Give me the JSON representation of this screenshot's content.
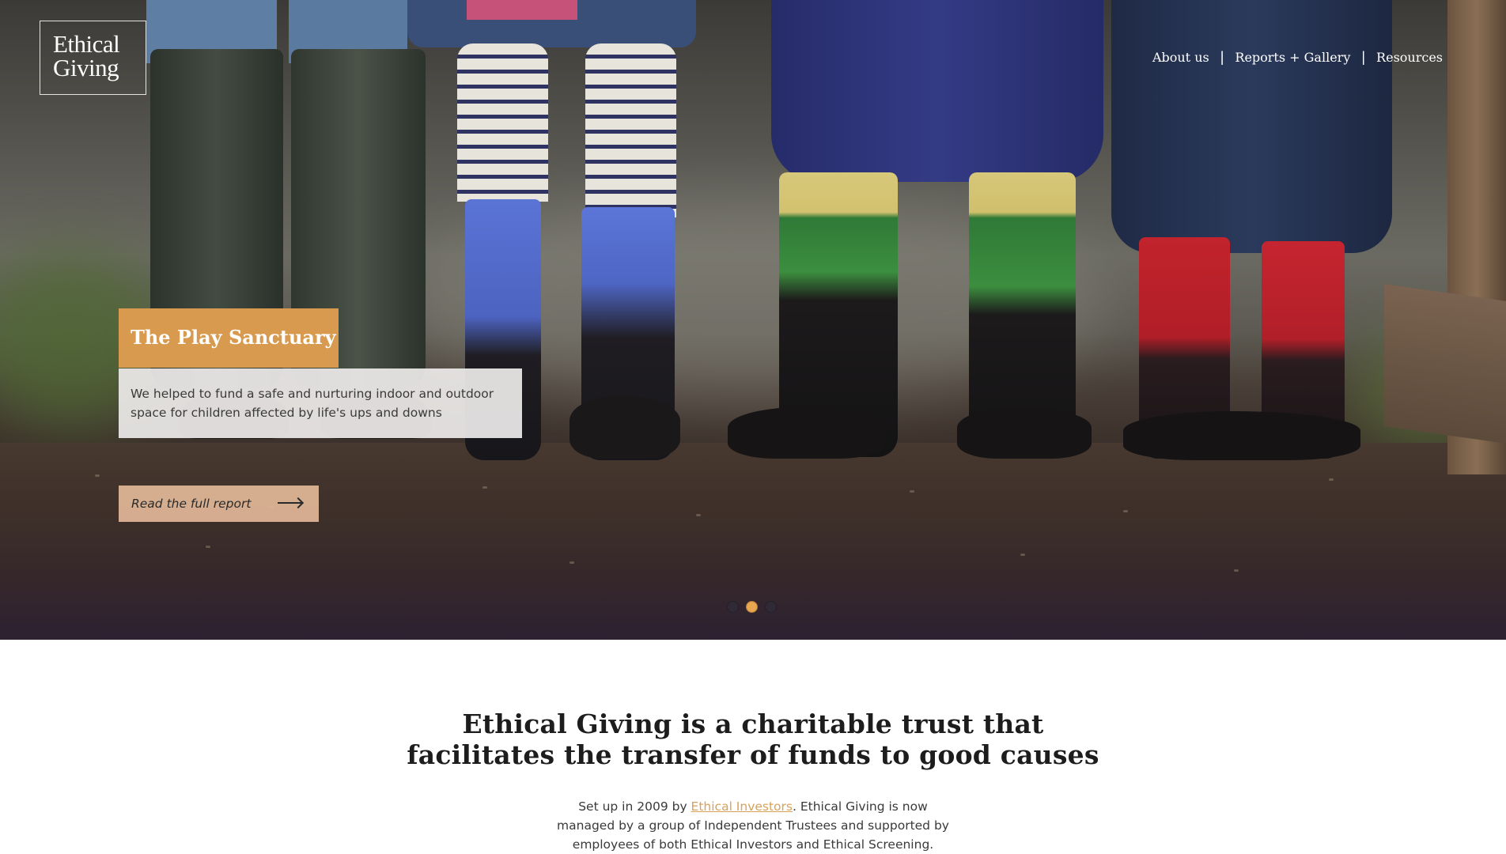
{
  "brand": {
    "line1": "Ethical",
    "line2": "Giving"
  },
  "nav": {
    "items": [
      {
        "label": "About us"
      },
      {
        "label": "Reports + Gallery"
      },
      {
        "label": "Resources"
      }
    ],
    "separator": "|"
  },
  "hero": {
    "slide_title": "The Play Sanctuary",
    "slide_description_line1": "We helped to fund a safe and nurturing indoor and outdoor",
    "slide_description_line2": "space for children affected by life's ups and downs",
    "cta_label": "Read the full report",
    "slides_count": 3,
    "active_slide": 2,
    "colors": {
      "title_bg": "#d89a4f",
      "cta_bg": "#e2b798",
      "active_dot": "#e7a64f"
    }
  },
  "intro": {
    "heading_line1": "Ethical Giving is a charitable trust that",
    "heading_line2": "facilitates the transfer of funds to good causes",
    "text_before_link": "Set up in 2009 by ",
    "link_text": "Ethical Investors",
    "text_after_link": ". Ethical Giving is now",
    "text_line2": "managed by a group of Independent Trustees and supported by",
    "text_line3": "employees of both Ethical Investors and Ethical Screening."
  }
}
